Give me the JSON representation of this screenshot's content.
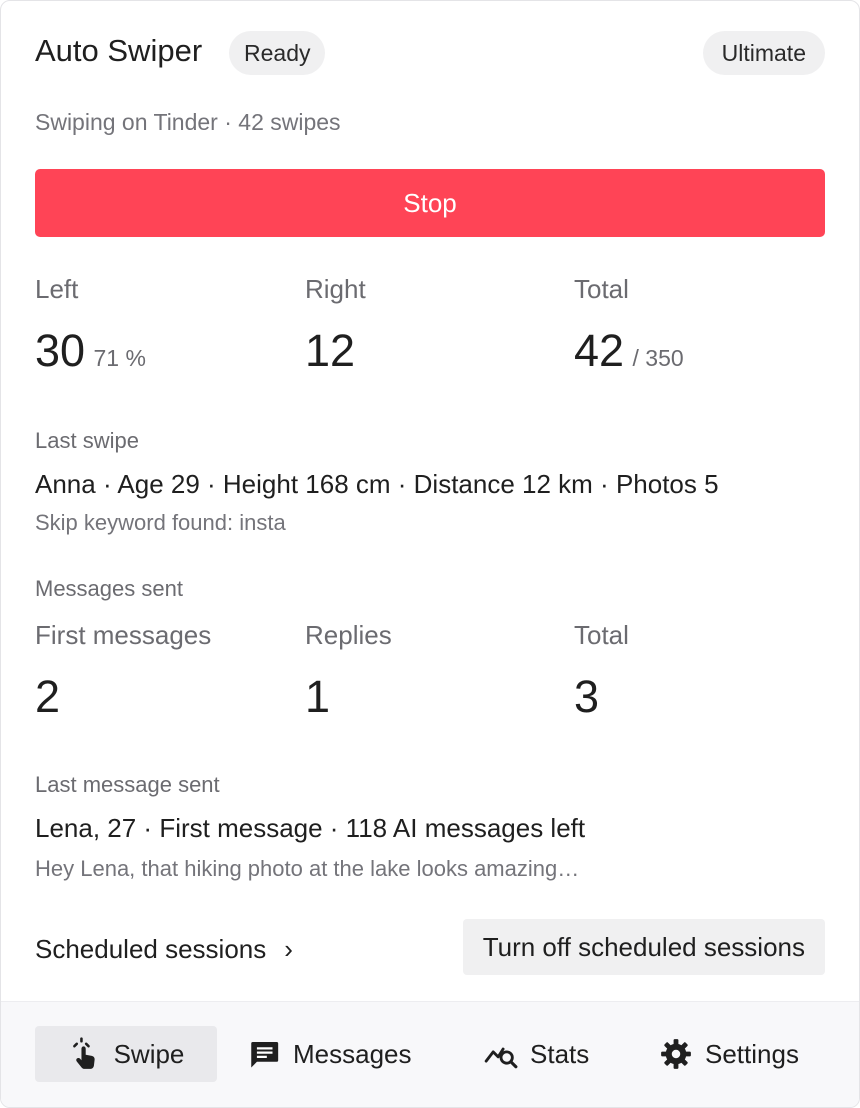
{
  "header": {
    "title": "Auto Swiper",
    "status_badge": "Ready",
    "plan_badge": "Ultimate"
  },
  "subtitle": "Swiping on Tinder · 42 swipes",
  "stop_button": {
    "label": "Stop",
    "color": "#ff4456"
  },
  "swipe_stats": {
    "left": {
      "label": "Left",
      "value": "30",
      "sub": "71 %"
    },
    "right": {
      "label": "Right",
      "value": "12"
    },
    "total": {
      "label": "Total",
      "value": "42",
      "sub": "/ 350"
    }
  },
  "last_swipe": {
    "label": "Last swipe",
    "details": "Anna · Age 29 · Height 168 cm · Distance 12 km · Photos 5",
    "note": "Skip keyword found: insta"
  },
  "messages_sent": {
    "label": "Messages sent",
    "first": {
      "label": "First messages",
      "value": "2"
    },
    "replies": {
      "label": "Replies",
      "value": "1"
    },
    "total": {
      "label": "Total",
      "value": "3"
    }
  },
  "last_message": {
    "label": "Last message sent",
    "details": "Lena, 27 · First message · 118 AI messages left",
    "preview": "Hey Lena, that hiking photo at the lake looks amazing…"
  },
  "scheduled": {
    "link_label": "Scheduled sessions",
    "chevron": "›",
    "turn_off_label": "Turn off scheduled sessions"
  },
  "nav": {
    "items": [
      {
        "label": "Swipe",
        "icon": "tap-hand-icon",
        "active": true
      },
      {
        "label": "Messages",
        "icon": "message-icon",
        "active": false
      },
      {
        "label": "Stats",
        "icon": "stats-search-icon",
        "active": false
      },
      {
        "label": "Settings",
        "icon": "gear-icon",
        "active": false
      }
    ]
  }
}
